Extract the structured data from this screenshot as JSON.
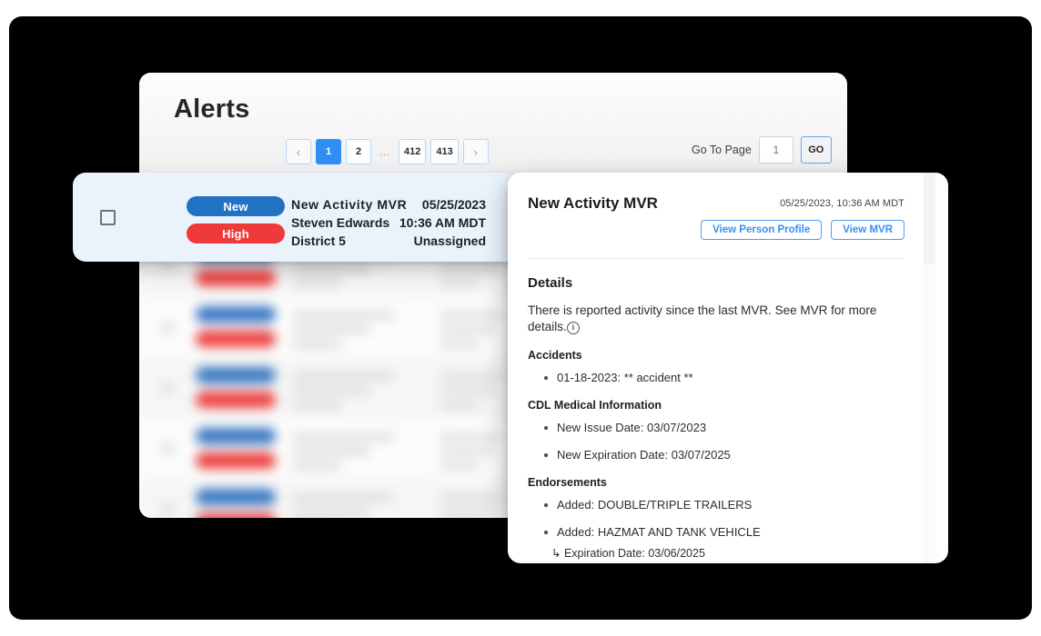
{
  "app": {
    "title": "Alerts"
  },
  "pagination": {
    "prev_icon": "chevron-left-icon",
    "next_icon": "chevron-right-icon",
    "prev_label": "‹",
    "next_label": "›",
    "pages": [
      "1",
      "2"
    ],
    "ellipsis": "…",
    "last_pages": [
      "412",
      "413"
    ],
    "active_page": "1",
    "goto_label": "Go To Page",
    "goto_value": "",
    "goto_placeholder": "1",
    "go_button": "GO"
  },
  "alert_row": {
    "status_badge": "New",
    "priority_badge": "High",
    "type": "New Activity MVR",
    "person": "Steven Edwards",
    "district": "District 5",
    "date": "05/25/2023",
    "time": "10:36 AM MDT",
    "assignment": "Unassigned"
  },
  "detail": {
    "title": "New Activity MVR",
    "timestamp": "05/25/2023, 10:36 AM MDT",
    "actions": [
      {
        "label": "View Person Profile"
      },
      {
        "label": "View MVR"
      }
    ],
    "details_heading": "Details",
    "summary": "There is reported activity since the last MVR. See MVR for more details.",
    "summary_info_icon": "info-circle-icon",
    "sections": [
      {
        "heading": "Accidents",
        "items": [
          {
            "text": "01-18-2023: ** accident **"
          }
        ]
      },
      {
        "heading": "CDL Medical Information",
        "items": [
          {
            "text": "New Issue Date: 03/07/2023"
          },
          {
            "text": "New Expiration Date: 03/07/2025"
          }
        ]
      },
      {
        "heading": "Endorsements",
        "items": [
          {
            "text": "Added: DOUBLE/TRIPLE TRAILERS"
          },
          {
            "text": "Added: HAZMAT AND TANK VEHICLE",
            "sub": "↳ Expiration Date: 03/06/2025"
          }
        ]
      }
    ]
  },
  "colors": {
    "badge_new": "#2272c4",
    "badge_high": "#ee3b39",
    "accent_blue": "#2f8ef4",
    "link_blue": "#3b8df2",
    "alert_card_bg": "#eaf2fb",
    "stage_bg": "#000000"
  }
}
